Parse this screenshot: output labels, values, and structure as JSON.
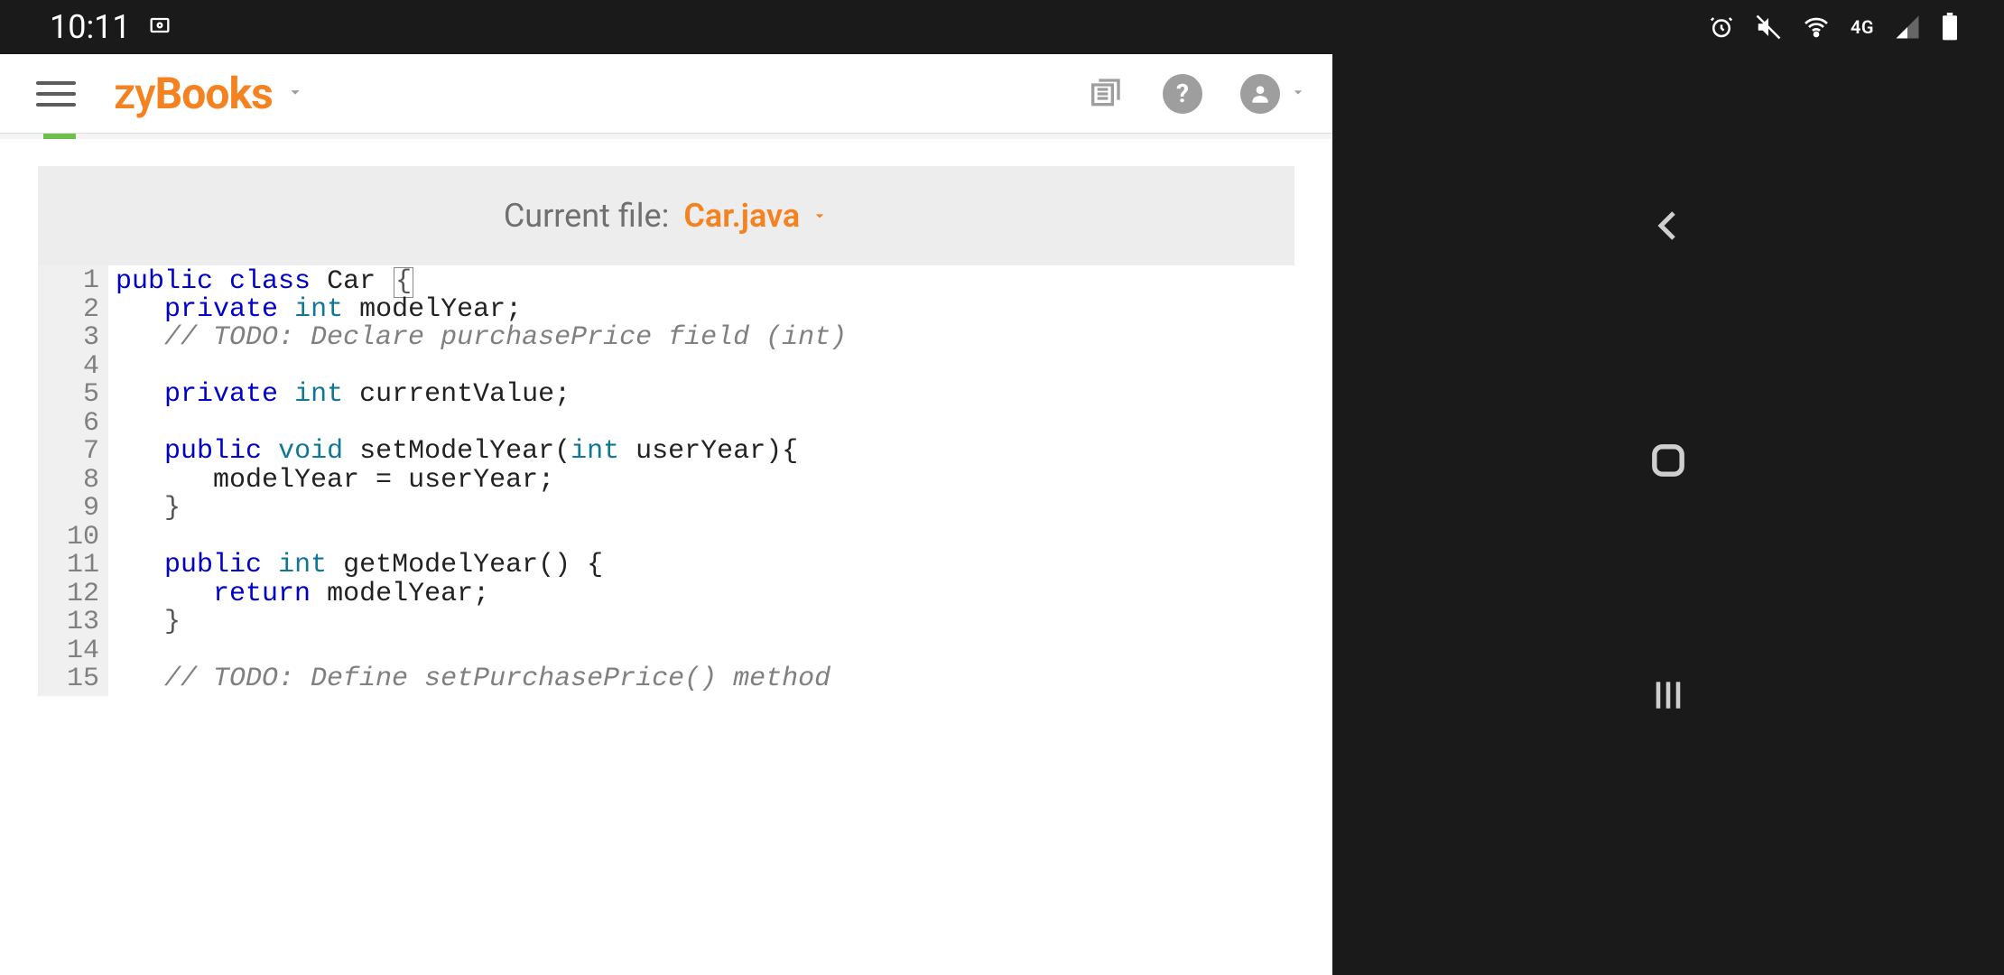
{
  "statusbar": {
    "time": "10:11",
    "network_tag": "4G"
  },
  "appbar": {
    "brand": "zyBooks"
  },
  "file_header": {
    "label": "Current file:",
    "filename": "Car.java"
  },
  "code": {
    "line_numbers": [
      "1",
      "2",
      "3",
      "4",
      "5",
      "6",
      "7",
      "8",
      "9",
      "10",
      "11",
      "12",
      "13",
      "14",
      "15"
    ],
    "lines": [
      {
        "tokens": [
          {
            "t": "public",
            "c": "kw"
          },
          {
            "t": " "
          },
          {
            "t": "class",
            "c": "kw"
          },
          {
            "t": " "
          },
          {
            "t": "Car",
            "c": "id"
          },
          {
            "t": " "
          },
          {
            "t": "{",
            "c": "punc",
            "cursor": true
          }
        ]
      },
      {
        "indent": 3,
        "tokens": [
          {
            "t": "private",
            "c": "kw"
          },
          {
            "t": " "
          },
          {
            "t": "int",
            "c": "type"
          },
          {
            "t": " "
          },
          {
            "t": "modelYear;",
            "c": "id"
          }
        ]
      },
      {
        "indent": 3,
        "tokens": [
          {
            "t": "// TODO: Declare purchasePrice field (int)",
            "c": "cmt"
          }
        ]
      },
      {
        "indent": 0,
        "tokens": []
      },
      {
        "indent": 3,
        "tokens": [
          {
            "t": "private",
            "c": "kw"
          },
          {
            "t": " "
          },
          {
            "t": "int",
            "c": "type"
          },
          {
            "t": " "
          },
          {
            "t": "currentValue;",
            "c": "id"
          }
        ]
      },
      {
        "indent": 0,
        "tokens": []
      },
      {
        "indent": 3,
        "tokens": [
          {
            "t": "public",
            "c": "kw"
          },
          {
            "t": " "
          },
          {
            "t": "void",
            "c": "type"
          },
          {
            "t": " "
          },
          {
            "t": "setModelYear(",
            "c": "id"
          },
          {
            "t": "int",
            "c": "type"
          },
          {
            "t": " "
          },
          {
            "t": "userYear){",
            "c": "id"
          }
        ]
      },
      {
        "indent": 6,
        "tokens": [
          {
            "t": "modelYear = userYear;",
            "c": "id"
          }
        ]
      },
      {
        "indent": 3,
        "tokens": [
          {
            "t": "}",
            "c": "punc"
          }
        ]
      },
      {
        "indent": 0,
        "tokens": []
      },
      {
        "indent": 3,
        "tokens": [
          {
            "t": "public",
            "c": "kw"
          },
          {
            "t": " "
          },
          {
            "t": "int",
            "c": "type"
          },
          {
            "t": " "
          },
          {
            "t": "getModelYear() {",
            "c": "id"
          }
        ]
      },
      {
        "indent": 6,
        "tokens": [
          {
            "t": "return",
            "c": "kw"
          },
          {
            "t": " "
          },
          {
            "t": "modelYear;",
            "c": "id"
          }
        ]
      },
      {
        "indent": 3,
        "tokens": [
          {
            "t": "}",
            "c": "punc"
          }
        ]
      },
      {
        "indent": 0,
        "tokens": []
      },
      {
        "indent": 3,
        "tokens": [
          {
            "t": "// TODO: Define setPurchasePrice() method",
            "c": "cmt"
          }
        ]
      }
    ]
  }
}
